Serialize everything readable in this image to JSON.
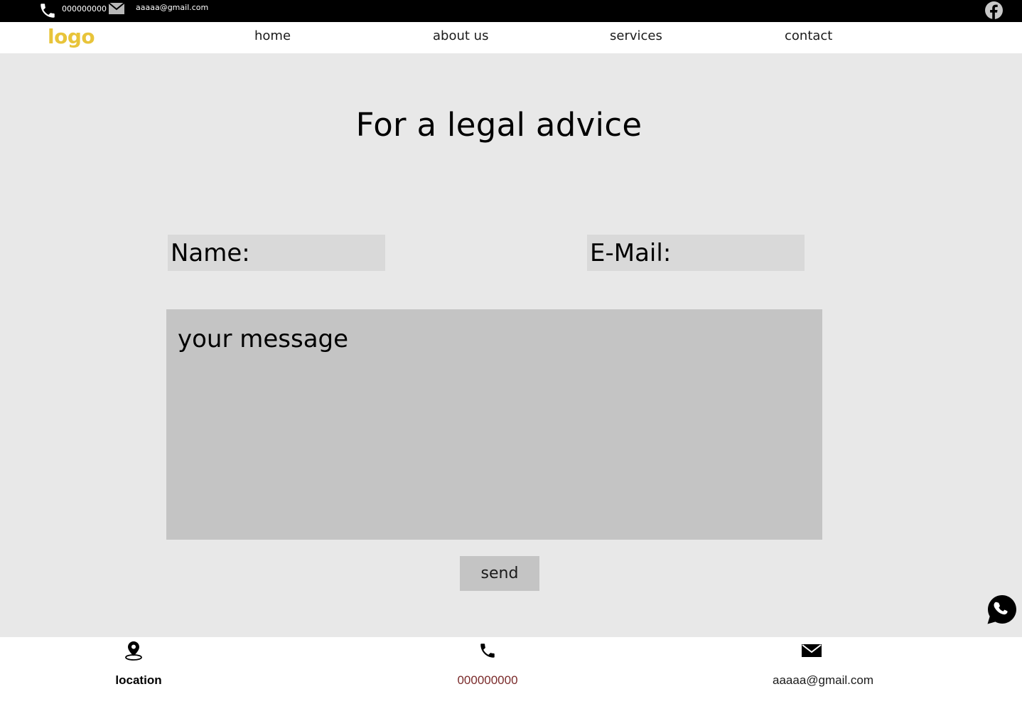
{
  "topbar": {
    "phone": "000000000",
    "email": "aaaaa@gmail.com",
    "phone_icon": "phone-icon",
    "mail_icon": "mail-icon",
    "social_icon": "facebook-icon"
  },
  "nav": {
    "logo": "logo",
    "links": [
      "home",
      "about us",
      "services",
      "contact"
    ]
  },
  "contact_form": {
    "title": "For a legal advice",
    "name_placeholder": "Name:",
    "email_placeholder": "E-Mail:",
    "message_placeholder": "your message",
    "send_label": "send"
  },
  "floating": {
    "icon": "whatsapp-icon"
  },
  "footer": {
    "location_label": "location",
    "phone": "000000000",
    "email": "aaaaa@gmail.com"
  },
  "colors": {
    "logo": "#e8c43a",
    "topbar_bg": "#000000",
    "page_bg": "#e8e8e8",
    "input_bg": "#d9d9d9",
    "message_bg": "#c4c4c4",
    "footer_phone": "#7a2a2a"
  }
}
